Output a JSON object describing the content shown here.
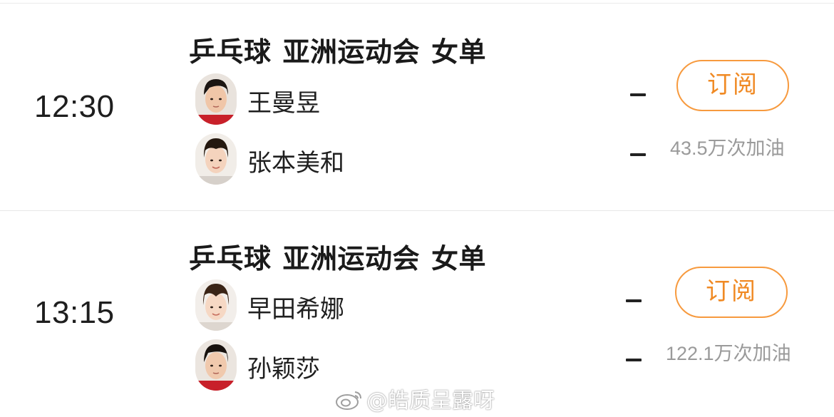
{
  "matches": [
    {
      "time": "12:30",
      "title": {
        "sport": "乒乓球",
        "event": "亚洲运动会",
        "category": "女单"
      },
      "players": [
        {
          "name": "王曼昱",
          "score": "-"
        },
        {
          "name": "张本美和",
          "score": "-"
        }
      ],
      "subscribe_label": "订阅",
      "cheer_count": "43.5万次加油"
    },
    {
      "time": "13:15",
      "title": {
        "sport": "乒乓球",
        "event": "亚洲运动会",
        "category": "女单"
      },
      "players": [
        {
          "name": "早田希娜",
          "score": "-"
        },
        {
          "name": "孙颖莎",
          "score": "-"
        }
      ],
      "subscribe_label": "订阅",
      "cheer_count": "122.1万次加油"
    }
  ],
  "watermark": {
    "text": "@皓质呈露呀",
    "icon": "weibo-icon"
  },
  "colors": {
    "accent": "#f08a24",
    "accent_border": "#f79a3e",
    "muted": "#9a9a9a",
    "divider": "#e8e8e8"
  }
}
